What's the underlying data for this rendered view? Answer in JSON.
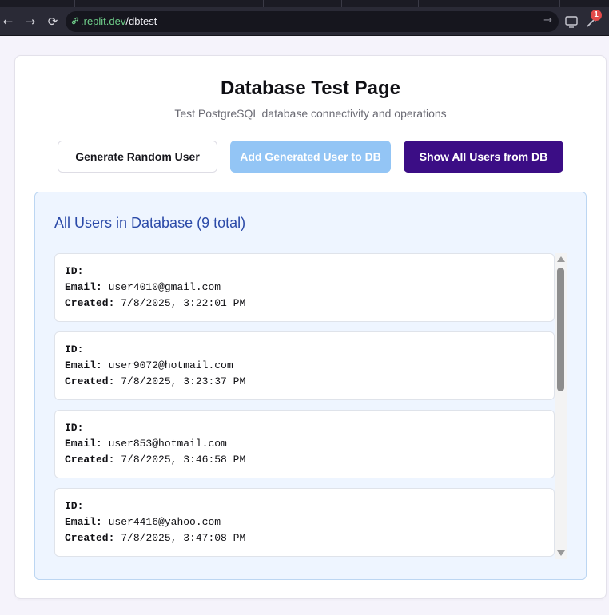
{
  "browser": {
    "url_domain": ".replit.dev",
    "url_path": "/dbtest",
    "back_icon": "←",
    "forward_icon": "→",
    "reload_icon": "⟳",
    "go_icon": "→",
    "notification_count": "1"
  },
  "page": {
    "title": "Database Test Page",
    "subtitle": "Test PostgreSQL database connectivity and operations"
  },
  "actions": {
    "generate_label": "Generate Random User",
    "add_label": "Add Generated User to DB",
    "show_label": "Show All Users from DB",
    "add_disabled": true
  },
  "users": {
    "heading": "All Users in Database (9 total)",
    "id_label": "ID:",
    "email_label": "Email:",
    "created_label": "Created:",
    "items": [
      {
        "id": "",
        "email": "user4010@gmail.com",
        "created": "7/8/2025, 3:22:01 PM"
      },
      {
        "id": "",
        "email": "user9072@hotmail.com",
        "created": "7/8/2025, 3:23:37 PM"
      },
      {
        "id": "",
        "email": "user853@hotmail.com",
        "created": "7/8/2025, 3:46:58 PM"
      },
      {
        "id": "",
        "email": "user4416@yahoo.com",
        "created": "7/8/2025, 3:47:08 PM"
      }
    ]
  },
  "colors": {
    "primary_button": "#3b0d85",
    "disabled_button": "#93c5f5",
    "heading_blue": "#2b4aa8",
    "panel_bg": "#eef5ff"
  }
}
